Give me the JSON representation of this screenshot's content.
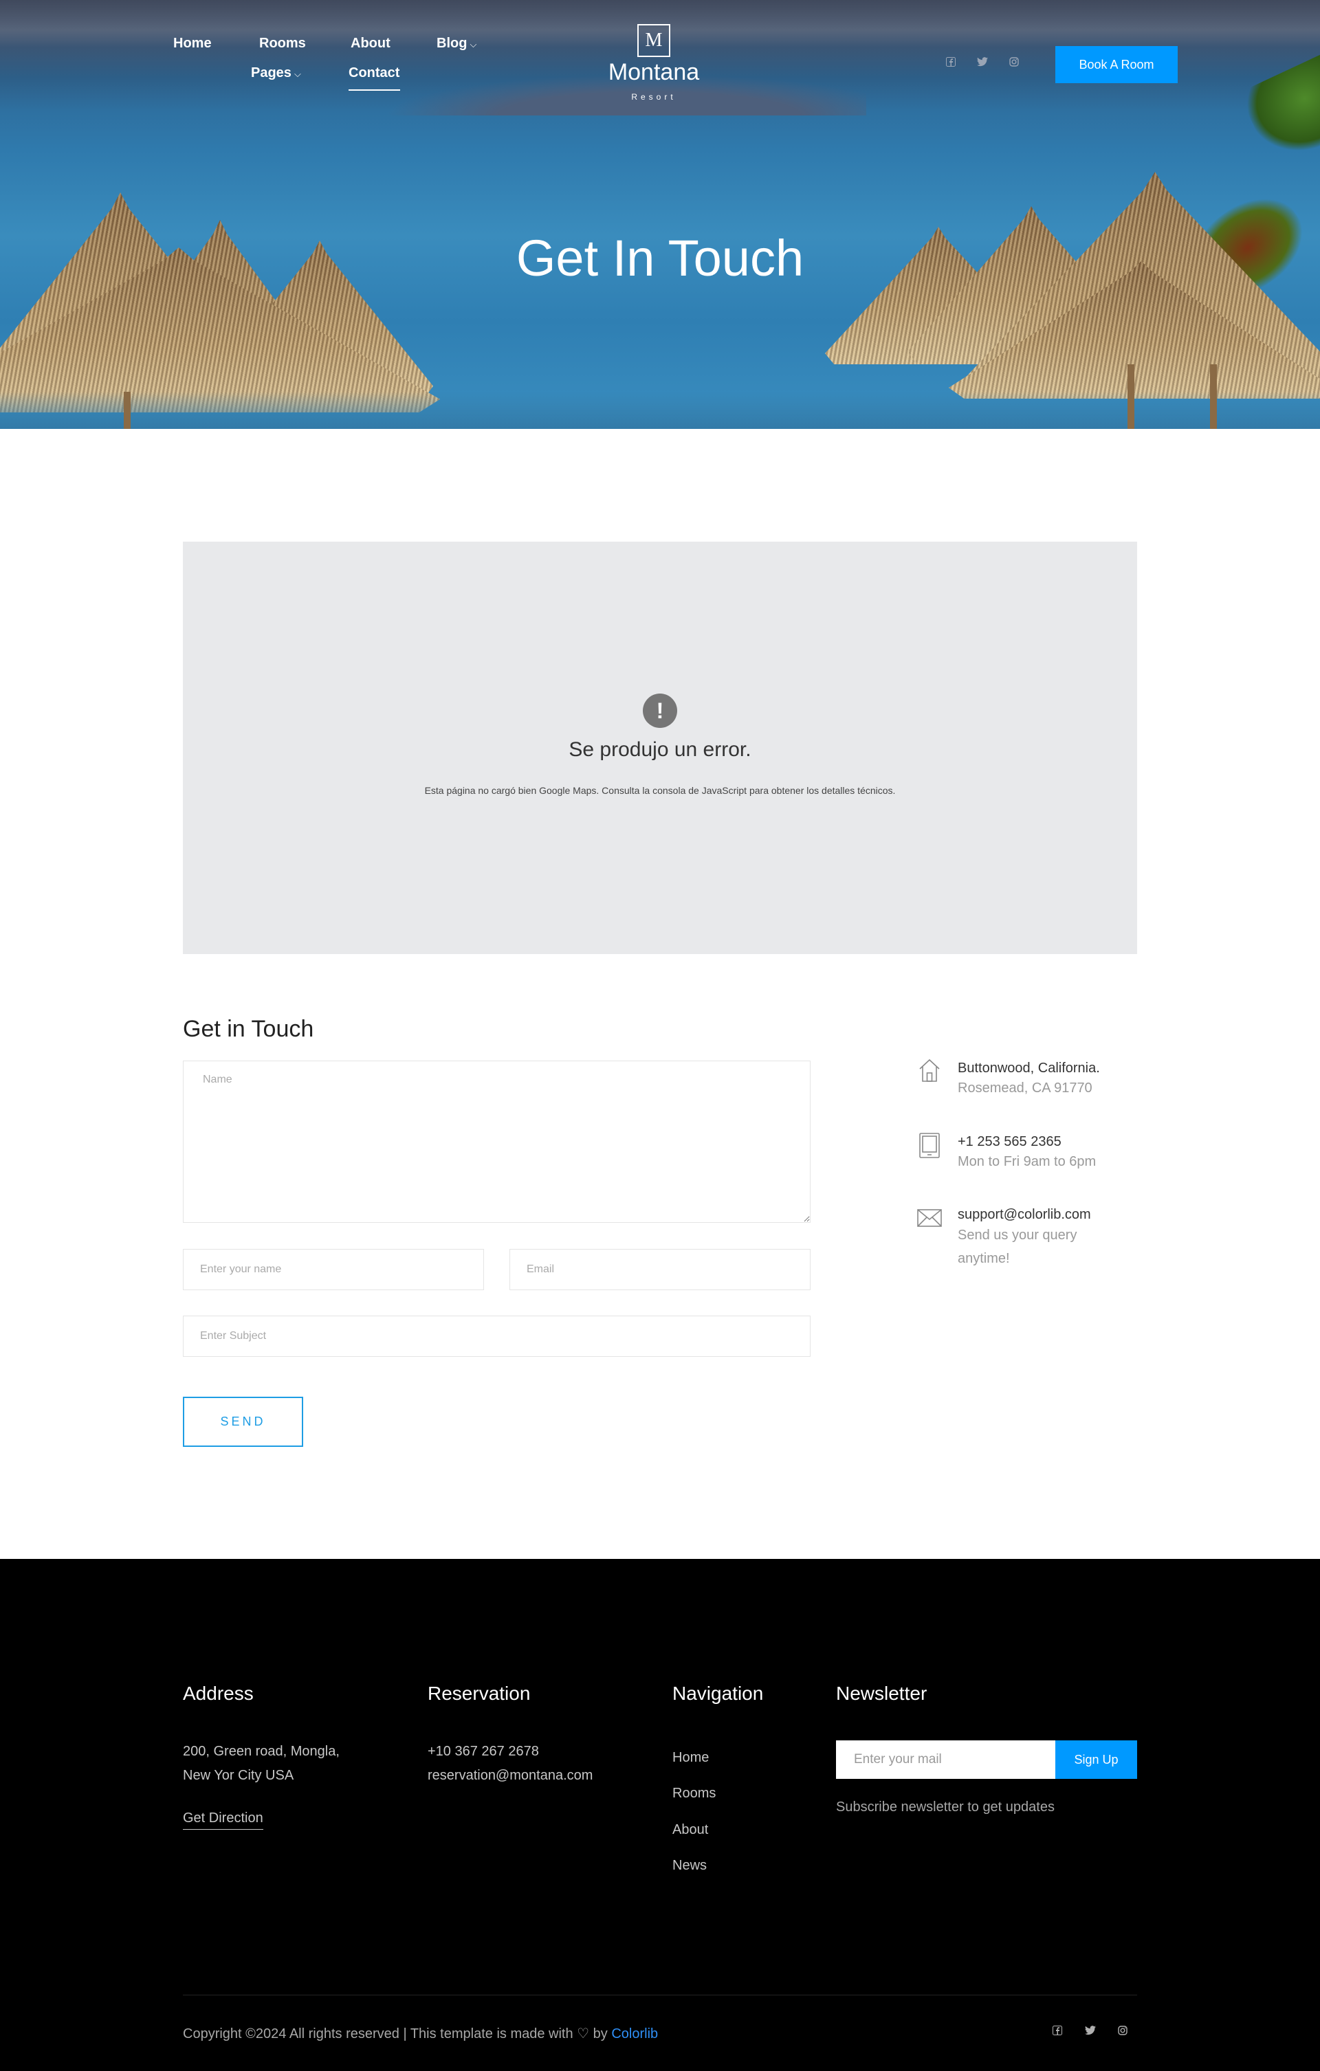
{
  "nav": {
    "items": [
      {
        "label": "Home"
      },
      {
        "label": "Rooms"
      },
      {
        "label": "About"
      },
      {
        "label": "Blog",
        "has_dropdown": true
      },
      {
        "label": "Pages",
        "has_dropdown": true
      },
      {
        "label": "Contact",
        "active": true
      }
    ],
    "dropdown_glyph": "⌵"
  },
  "logo": {
    "letter": "M",
    "name": "Montana",
    "subtitle": "Resort"
  },
  "header_social": [
    "facebook-icon",
    "twitter-icon",
    "instagram-icon"
  ],
  "book_button": "Book A Room",
  "hero": {
    "title": "Get In Touch"
  },
  "map": {
    "icon": "!",
    "error_title": "Se produjo un error.",
    "error_text": "Esta página no cargó bien Google Maps. Consulta la consola de JavaScript para obtener los detalles técnicos."
  },
  "contact": {
    "title": "Get in Touch",
    "message_placeholder": "Name",
    "name_placeholder": "Enter your name",
    "email_placeholder": "Email",
    "subject_placeholder": "Enter Subject",
    "send_label": "SEND",
    "info": [
      {
        "icon": "home-icon",
        "title": "Buttonwood, California.",
        "subtitle": "Rosemead, CA 91770"
      },
      {
        "icon": "tablet-icon",
        "title": "+1 253 565 2365",
        "subtitle": "Mon to Fri 9am to 6pm"
      },
      {
        "icon": "envelope-icon",
        "title": "support@colorlib.com",
        "subtitle": "Send us your query anytime!"
      }
    ]
  },
  "footer": {
    "address": {
      "heading": "Address",
      "line1": "200, Green road, Mongla,",
      "line2": "New Yor City USA",
      "link": "Get Direction"
    },
    "reservation": {
      "heading": "Reservation",
      "phone": "+10 367 267 2678",
      "email": "reservation@montana.com"
    },
    "navigation": {
      "heading": "Navigation",
      "links": [
        "Home",
        "Rooms",
        "About",
        "News"
      ]
    },
    "newsletter": {
      "heading": "Newsletter",
      "placeholder": "Enter your mail",
      "button": "Sign Up",
      "note": "Subscribe newsletter to get updates"
    },
    "copyright": {
      "prefix": "Copyright ©2024 All rights reserved | This template is made with",
      "heart": "♡",
      "by": "by",
      "brand": "Colorlib"
    },
    "social": [
      "facebook-icon",
      "twitter-icon",
      "instagram-icon"
    ]
  },
  "colors": {
    "accent": "#0099ff",
    "footer_bg": "#000000",
    "map_bg": "#e8e9eb"
  }
}
